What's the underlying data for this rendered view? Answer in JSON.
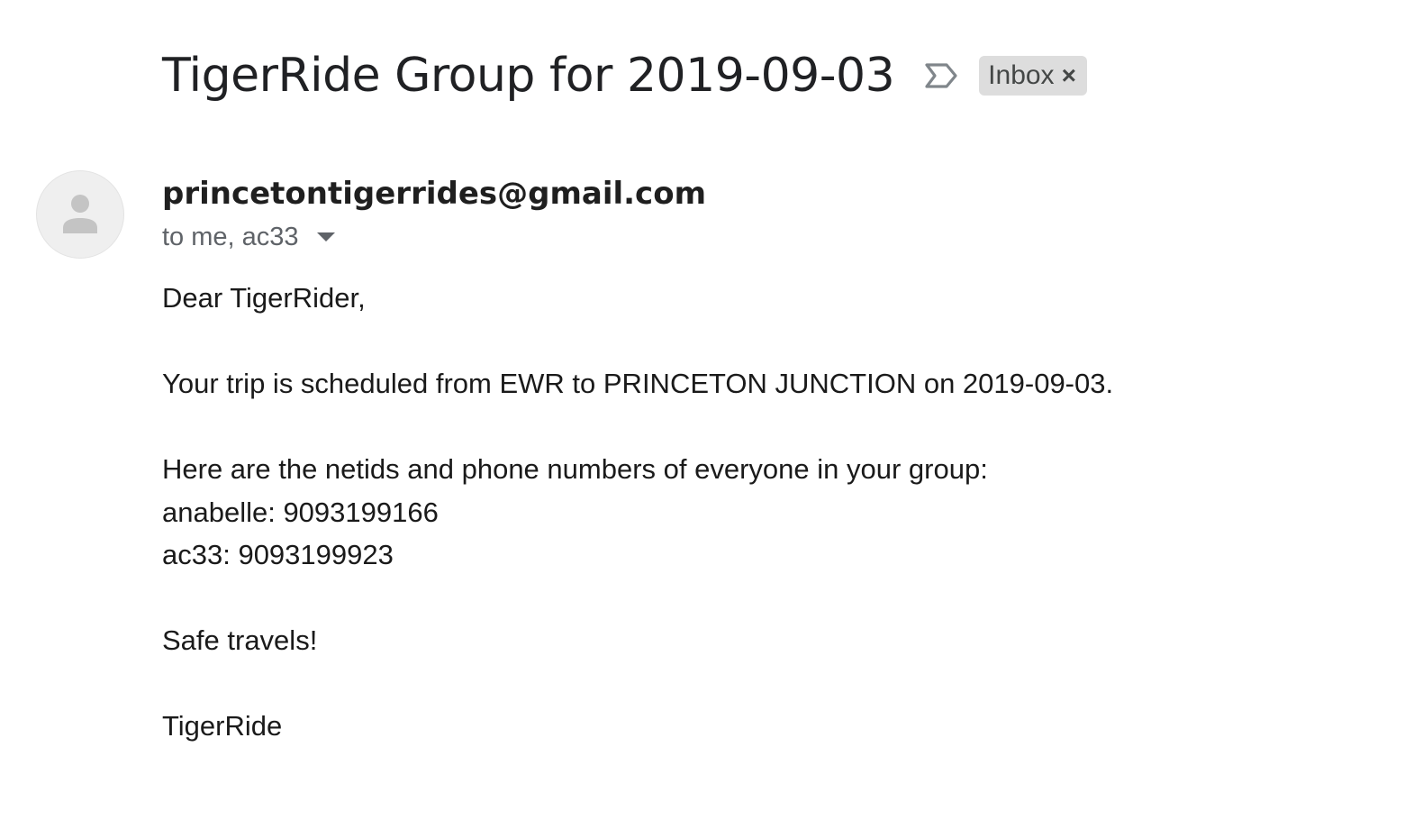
{
  "email": {
    "subject": "TigerRide Group for 2019-09-03",
    "label_chip": {
      "text": "Inbox",
      "close_glyph": "×"
    },
    "importance_icon": "importance-marker-icon",
    "avatar_icon": "person-icon",
    "sender": "princetontigerrides@gmail.com",
    "recipients": "to me, ac33",
    "details_icon": "caret-down-icon",
    "body": {
      "greeting": "Dear TigerRider,",
      "trip_line": "Your trip is scheduled from EWR to PRINCETON JUNCTION on 2019-09-03.",
      "group_intro": "Here are the netids and phone numbers of everyone in your group:",
      "members": [
        "anabelle: 9093199166",
        "ac33: 9093199923"
      ],
      "closing": "Safe travels!",
      "signature": "TigerRide"
    }
  },
  "colors": {
    "text_primary": "#202124",
    "text_secondary": "#5f6368",
    "chip_background": "#dddddd",
    "avatar_background": "#efefef",
    "icon_gray": "#80868b"
  }
}
